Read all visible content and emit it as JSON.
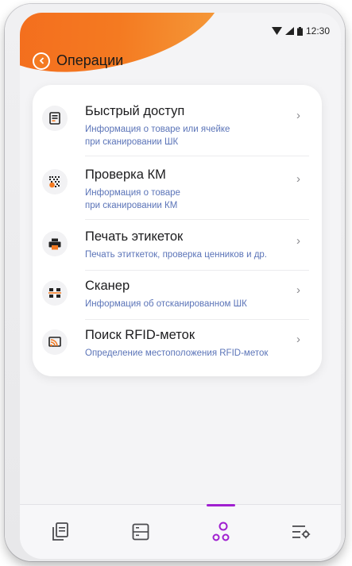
{
  "status": {
    "time": "12:30"
  },
  "header": {
    "title": "Операции"
  },
  "menu": [
    {
      "label": "Быстрый доступ",
      "subtitle_lines": [
        "Информация о товаре или ячейке",
        "при сканировании ШК"
      ],
      "icon": "document-icon"
    },
    {
      "label": "Проверка КМ",
      "subtitle_lines": [
        "Информация о товаре",
        "при сканировании КМ"
      ],
      "icon": "datamatrix-icon"
    },
    {
      "label": "Печать этикеток",
      "subtitle_lines": [
        "Печать этиткеток, проверка ценников и др."
      ],
      "icon": "printer-icon"
    },
    {
      "label": "Сканер",
      "subtitle_lines": [
        "Информация об отсканированном ШК"
      ],
      "icon": "scanner-icon"
    },
    {
      "label": "Поиск RFID-меток",
      "subtitle_lines": [
        "Определение местоположения RFID-меток"
      ],
      "icon": "rfid-icon"
    }
  ],
  "tabs": [
    {
      "icon": "documents-icon",
      "active": false
    },
    {
      "icon": "storage-icon",
      "active": false
    },
    {
      "icon": "operations-icon",
      "active": true
    },
    {
      "icon": "settings-icon",
      "active": false
    }
  ],
  "colors": {
    "accent": "#f47a21",
    "active_tab": "#a01fd0",
    "subtitle": "#5b74b8"
  }
}
